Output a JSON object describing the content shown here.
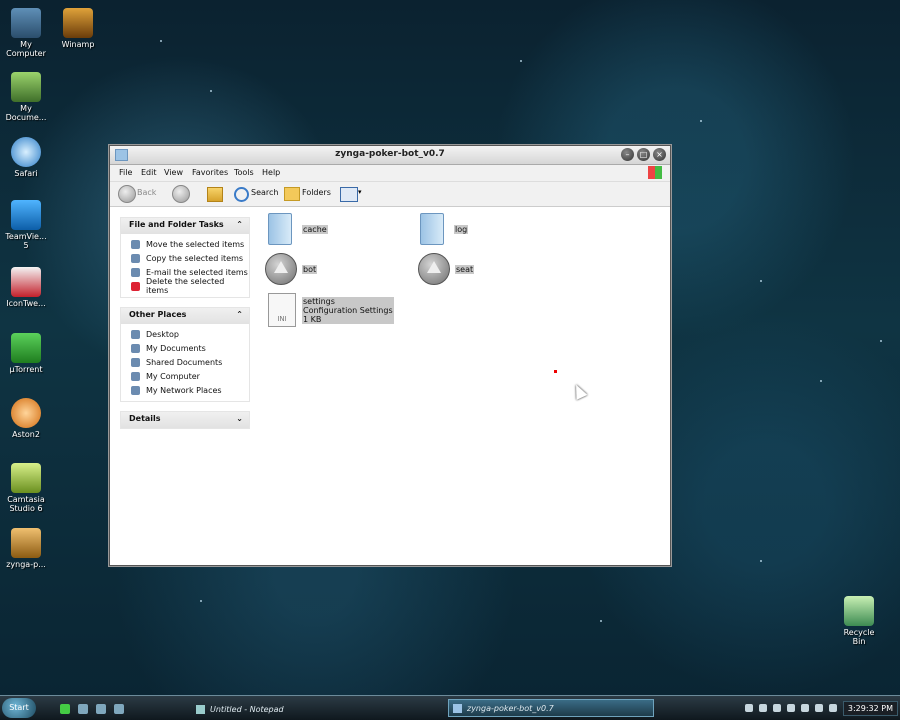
{
  "desktop": {
    "icons": [
      {
        "label": "My\nComputer"
      },
      {
        "label": "Winamp"
      },
      {
        "label": "My\nDocume..."
      },
      {
        "label": "Safari"
      },
      {
        "label": "TeamVie...\n5"
      },
      {
        "label": "IconTwe..."
      },
      {
        "label": "µTorrent"
      },
      {
        "label": "Aston2"
      },
      {
        "label": "Camtasia\nStudio 6"
      },
      {
        "label": "zynga-p..."
      },
      {
        "label": "Recycle\nBin"
      }
    ]
  },
  "window": {
    "title": "zynga-poker-bot_v0.7",
    "menu": [
      "File",
      "Edit",
      "View",
      "Favorites",
      "Tools",
      "Help"
    ],
    "toolbar": {
      "back": "Back",
      "search": "Search",
      "folders": "Folders"
    },
    "tasks": {
      "file_folder": {
        "title": "File and Folder Tasks",
        "items": [
          "Move the selected items",
          "Copy the selected items",
          "E-mail the selected items",
          "Delete the selected items"
        ]
      },
      "other_places": {
        "title": "Other Places",
        "items": [
          "Desktop",
          "My Documents",
          "Shared Documents",
          "My Computer",
          "My Network Places"
        ]
      },
      "details": {
        "title": "Details"
      }
    },
    "files": [
      {
        "name": "cache"
      },
      {
        "name": "log"
      },
      {
        "name": "bot"
      },
      {
        "name": "seat"
      },
      {
        "name": "settings",
        "type": "Configuration Settings",
        "size": "1 KB",
        "badge": "INI"
      }
    ]
  },
  "taskbar": {
    "start": "Start",
    "tasks": [
      {
        "label": "Untitled - Notepad"
      },
      {
        "label": "zynga-poker-bot_v0.7"
      }
    ],
    "clock": "3:29:32 PM"
  }
}
